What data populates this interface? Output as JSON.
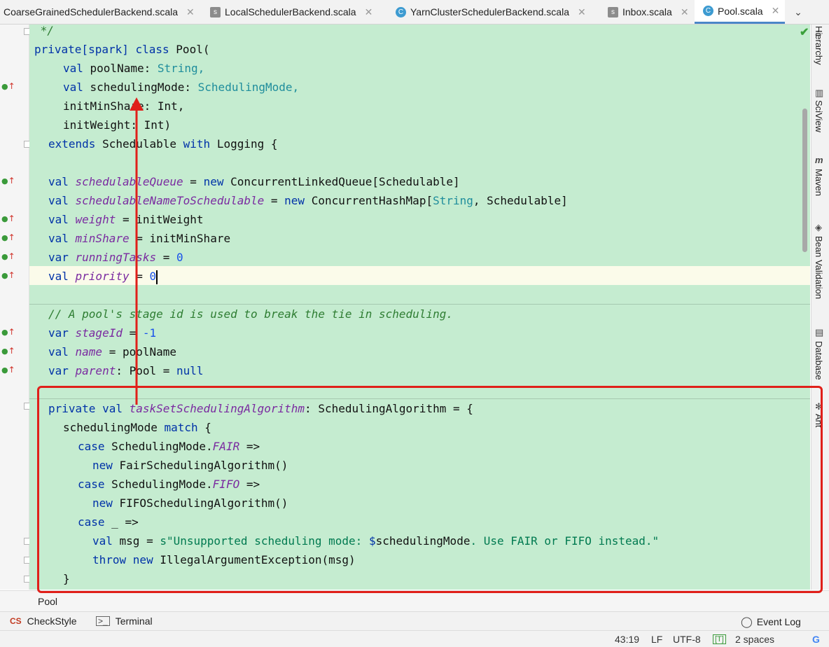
{
  "tabs": [
    {
      "label": "CoarseGrainedSchedulerBackend.scala",
      "icon": "scala-object-icon",
      "active": false
    },
    {
      "label": "LocalSchedulerBackend.scala",
      "icon": "scala-file-icon",
      "active": false
    },
    {
      "label": "YarnClusterSchedulerBackend.scala",
      "icon": "scala-class-icon",
      "active": false
    },
    {
      "label": "Inbox.scala",
      "icon": "scala-file-icon",
      "active": false
    },
    {
      "label": "Pool.scala",
      "icon": "scala-class-icon",
      "active": true
    }
  ],
  "tab_close_glyph": "✕",
  "code": {
    "l01": {
      "a": " */"
    },
    "l02": {
      "a": "private[spark] ",
      "b": "class ",
      "c": "Pool("
    },
    "l03": {
      "a": "val ",
      "b": "poolName: ",
      "c": "String,"
    },
    "l04": {
      "a": "val ",
      "b": "schedulingMode: ",
      "c": "SchedulingMode,"
    },
    "l05": {
      "a": "initMinShare: Int,"
    },
    "l06": {
      "a": "initWeight: Int)"
    },
    "l07": {
      "a": "extends ",
      "b": "Schedulable ",
      "c": "with ",
      "d": "Logging {"
    },
    "l08": {
      "a": "val ",
      "b": "schedulableQueue",
      "c": " = ",
      "d": "new ",
      "e": "ConcurrentLinkedQueue[Schedulable]"
    },
    "l09": {
      "a": "val ",
      "b": "schedulableNameToSchedulable",
      "c": " = ",
      "d": "new ",
      "e": "ConcurrentHashMap[",
      "f": "String",
      "g": ", Schedulable]"
    },
    "l10": {
      "a": "val ",
      "b": "weight",
      "c": " = initWeight"
    },
    "l11": {
      "a": "val ",
      "b": "minShare",
      "c": " = initMinShare"
    },
    "l12": {
      "a": "var ",
      "b": "runningTasks",
      "c": " = ",
      "d": "0"
    },
    "l13": {
      "a": "val ",
      "b": "priority",
      "c": " = ",
      "d": "0"
    },
    "l14": {
      "a": "// A pool's stage id is used to break the tie in scheduling."
    },
    "l15": {
      "a": "var ",
      "b": "stageId",
      "c": " = ",
      "d": "-1"
    },
    "l16": {
      "a": "val ",
      "b": "name",
      "c": " = poolName"
    },
    "l17": {
      "a": "var ",
      "b": "parent",
      "c": ": Pool = ",
      "d": "null"
    },
    "l18": {
      "a": "private val ",
      "b": "taskSetSchedulingAlgorithm",
      "c": ": SchedulingAlgorithm = {"
    },
    "l19": {
      "a": "schedulingMode ",
      "b": "match",
      "c": " {"
    },
    "l20": {
      "a": "case ",
      "b": "SchedulingMode.",
      "c": "FAIR",
      "d": " =>"
    },
    "l21": {
      "a": "new ",
      "b": "FairSchedulingAlgorithm()"
    },
    "l22": {
      "a": "case ",
      "b": "SchedulingMode.",
      "c": "FIFO",
      "d": " =>"
    },
    "l23": {
      "a": "new ",
      "b": "FIFOSchedulingAlgorithm()"
    },
    "l24": {
      "a": "case ",
      "b": "_ =>"
    },
    "l25": {
      "a": "val ",
      "b": "msg = ",
      "c": "s\"Unsupported scheduling mode: ",
      "d": "$",
      "e": "schedulingMode",
      "f": ". Use FAIR or FIFO instead.\""
    },
    "l26": {
      "a": "throw ",
      "b": "new ",
      "c": "IllegalArgumentException(msg)"
    },
    "l27": {
      "a": "}"
    }
  },
  "right_tools": [
    "Hierarchy",
    "SciView",
    "Maven",
    "Bean Validation",
    "Database",
    "Ant"
  ],
  "breadcrumb": "Pool",
  "tool_windows": {
    "checkstyle": "CheckStyle",
    "terminal": "Terminal",
    "event_log": "Event Log"
  },
  "status": {
    "position": "43:19",
    "line_sep": "LF",
    "encoding": "UTF-8",
    "indent": "2 spaces"
  },
  "colors": {
    "editor_bg": "#c5ecd0",
    "annotation": "#e0201a",
    "keyword": "#0032a8",
    "field": "#7a2aa0",
    "comment": "#2e7d32"
  }
}
